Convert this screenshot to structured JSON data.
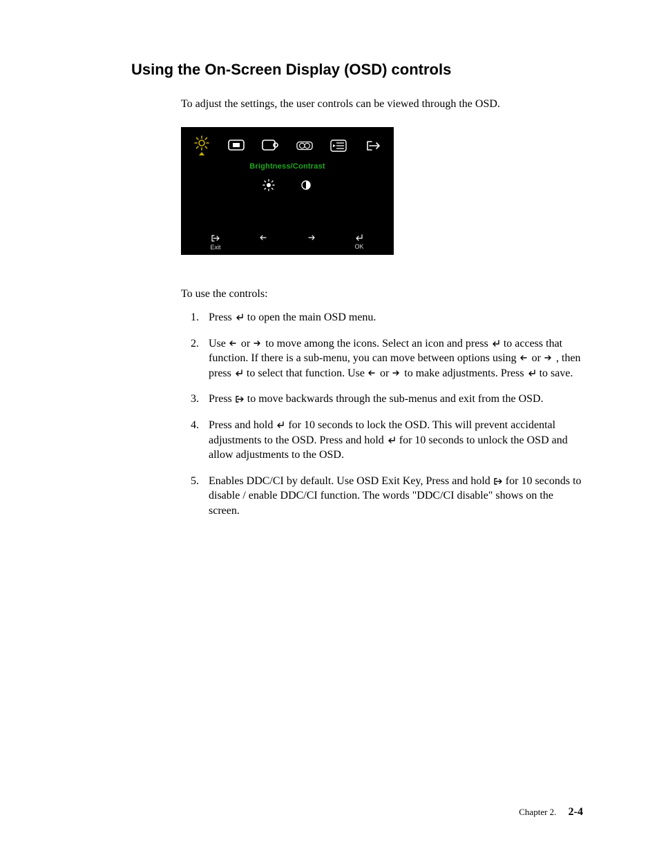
{
  "title": "Using the On-Screen Display (OSD) controls",
  "intro": "To adjust the settings,  the user controls can be viewed through the OSD.",
  "osd": {
    "title": "Brightness/Contrast",
    "top_icons": [
      "brightness",
      "monitor",
      "picture",
      "color",
      "settings",
      "exit"
    ],
    "sub_icons": [
      "brightness-sun",
      "contrast-half"
    ],
    "bottom": {
      "exit_label": "Exit",
      "ok_label": "OK"
    }
  },
  "intro2": "To use the controls:",
  "list": {
    "item1_a": "Press ",
    "item1_b": " to open the main OSD menu.",
    "item2_a": "Use ",
    "item2_b": " or ",
    "item2_c": " to move among the icons. Select an icon and press  ",
    "item2_d": " to access that function. If there is a sub-menu, you can move between options using  ",
    "item2_e": " or ",
    "item2_f": " , then press  ",
    "item2_g": " to select that function. Use ",
    "item2_h": " or ",
    "item2_i": " to make adjustments. Press ",
    "item2_j": " to save.",
    "item3_a": "Press ",
    "item3_b": " to move backwards through the sub-menus and exit from the OSD.",
    "item4_a": "Press and hold  ",
    "item4_b": "  for 10 seconds to lock the OSD. This will prevent accidental adjustments to the OSD. Press and hold ",
    "item4_c": "  for 10 seconds to unlock the OSD and allow adjustments to the OSD.",
    "item5_a": "Enables DDC/CI by default. Use OSD Exit Key,  Press and hold ",
    "item5_b": " for 10 seconds to disable / enable DDC/CI function. The words \"DDC/CI disable\" shows on the screen."
  },
  "footer": {
    "chapter": "Chapter 2.",
    "page": "2-4"
  }
}
